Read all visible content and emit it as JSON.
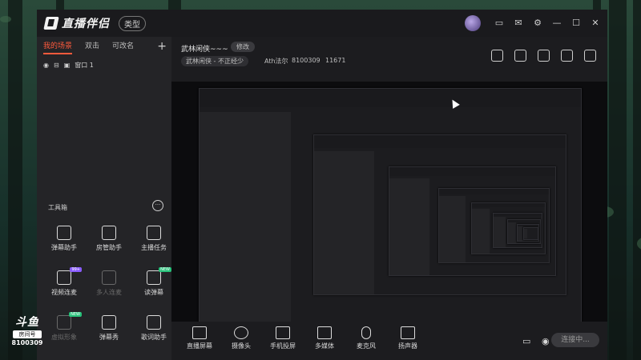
{
  "app": {
    "name": "直播伴侣",
    "mode_label": "类型"
  },
  "left_panel": {
    "tabs": [
      {
        "label": "我的场景",
        "active": true
      },
      {
        "label": "双击",
        "active": false
      },
      {
        "label": "可改名",
        "active": false
      }
    ],
    "source_name": "窗口 1",
    "tools_title": "工具箱",
    "tools": [
      {
        "label": "弹幕助手",
        "dim": false,
        "tag": ""
      },
      {
        "label": "房管助手",
        "dim": false,
        "tag": ""
      },
      {
        "label": "主播任务",
        "dim": false,
        "tag": ""
      },
      {
        "label": "视频连麦",
        "dim": false,
        "tag": "99+"
      },
      {
        "label": "多人连麦",
        "dim": true,
        "tag": ""
      },
      {
        "label": "读弹幕",
        "dim": false,
        "tag": "NEW"
      },
      {
        "label": "虚拟形象",
        "dim": true,
        "tag": "NEW"
      },
      {
        "label": "弹幕秀",
        "dim": false,
        "tag": ""
      },
      {
        "label": "歌词助手",
        "dim": false,
        "tag": ""
      }
    ]
  },
  "header": {
    "room_title": "武林闲侠~~~",
    "edit_label": "修改",
    "category": "武林闲侠 - 不正经少",
    "anchor": "Ath法尔",
    "room_id": "8100309",
    "hot_value": "11671"
  },
  "bottom": {
    "buttons": [
      {
        "label": "直播屏幕",
        "icon": "screen-icon"
      },
      {
        "label": "摄像头",
        "icon": "camera-icon"
      },
      {
        "label": "手机投屏",
        "icon": "phone-cast-icon"
      },
      {
        "label": "多媒体",
        "icon": "media-icon"
      },
      {
        "label": "麦克风",
        "icon": "mic-icon"
      },
      {
        "label": "扬声器",
        "icon": "speaker-icon"
      }
    ],
    "start_label": "连接中..."
  },
  "watermark": {
    "logo": "斗鱼",
    "room_label": "房间号",
    "id": "8100309"
  },
  "colors": {
    "accent": "#ff5a3c",
    "panel": "#242427",
    "window": "#1c1c1f"
  }
}
